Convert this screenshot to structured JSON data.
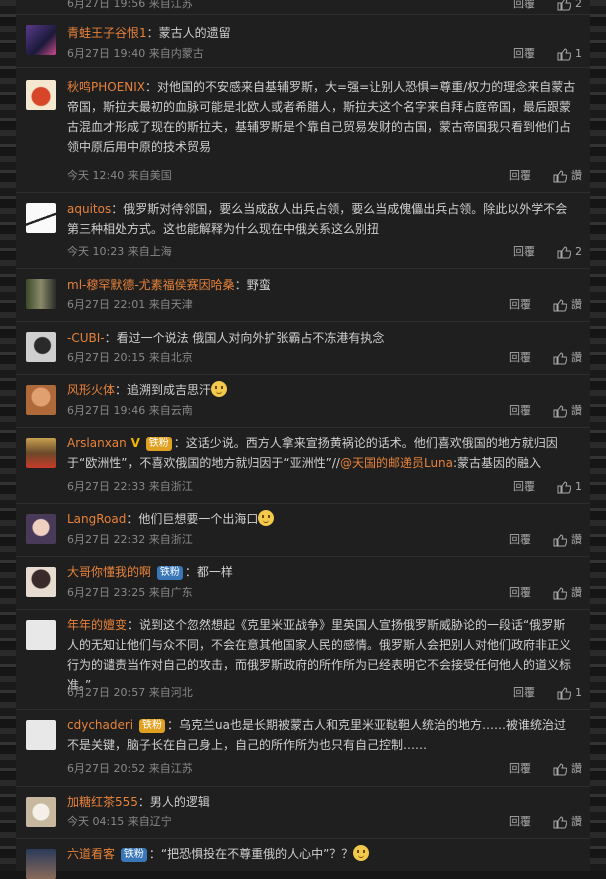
{
  "top_partial": {
    "meta": "6月27日 19:56 来自江苏",
    "reply": "回覆",
    "likes": "2"
  },
  "comments": [
    {
      "user": "青蛙王子谷恨1",
      "text": "蒙古人的遗留",
      "meta": "6月27日 19:40 来自内蒙古",
      "reply": "回覆",
      "likes": "1",
      "avatar": "#3b2a5a"
    },
    {
      "user": "秋鸣PHOENIX",
      "text": "对他国的不安感来自基辅罗斯，大=强=让别人恐惧=尊重/权力的理念来自蒙古帝国，斯拉夫最初的血脉可能是北欧人或者希腊人，斯拉夫这个名字来自拜占庭帝国，最后跟蒙古混血才形成了现在的斯拉夫，基辅罗斯是个靠自己贸易发财的古国，蒙古帝国我只看到他们占领中原后用中原的技术贸易",
      "meta": "今天 12:40 来自美国",
      "reply": "回覆",
      "likes": "讚",
      "avatar": "#c8552a"
    },
    {
      "user": "aquitos",
      "text": "俄罗斯对待邻国，要么当成敌人出兵占领，要么当成傀儡出兵占领。除此以外学不会第三种相处方式。这也能解释为什么现在中俄关系这么别扭",
      "meta": "今天 10:23 来自上海",
      "reply": "回覆",
      "likes": "2",
      "avatar": "#dddddd"
    },
    {
      "user": "ml-穆罕默德-尤素福侯赛因哈桑",
      "text": "野蛮",
      "meta": "6月27日 22:01 来自天津",
      "reply": "回覆",
      "likes": "讚",
      "avatar": "#556a4a"
    },
    {
      "user": "-CUBI-",
      "text": "看过一个说法 俄国人对向外扩张霸占不冻港有执念",
      "meta": "6月27日 20:15 来自北京",
      "reply": "回覆",
      "likes": "讚",
      "avatar": "#444444"
    },
    {
      "user": "风形火体",
      "text": "追溯到成吉思汗",
      "meta": "6月27日 19:46 来自云南",
      "reply": "回覆",
      "likes": "讚",
      "avatar": "#c98a5a",
      "emoji": true
    },
    {
      "user": "Arslanxan",
      "vip": "V",
      "badge": "铁粉",
      "text": "这话少说。西方人拿来宣扬黄祸论的话术。他们喜欢俄国的地方就归因于“欧洲性”，不喜欢俄国的地方就归因于“亚洲性”//",
      "mention": "@天国的邮递员Luna",
      "tail": ":蒙古基因的融入",
      "meta": "6月27日 22:33 来自浙江",
      "reply": "回覆",
      "likes": "1",
      "avatar": "#8a6a3a"
    },
    {
      "user": "LangRoad",
      "text": "他们巨想要一个出海口",
      "meta": "6月27日 22:32 来自浙江",
      "reply": "回覆",
      "likes": "讚",
      "avatar": "#b77a8a",
      "emoji": true
    },
    {
      "user": "大哥你懂我的啊",
      "badge": "铁粉",
      "text": "都一样",
      "meta": "6月27日 23:25 来自广东",
      "reply": "回覆",
      "likes": "讚",
      "avatar": "#e0d0c0"
    },
    {
      "user": "年年的嬗变",
      "text": "说到这个忽然想起《克里米亚战争》里英国人宣扬俄罗斯威胁论的一段话“俄罗斯人的无知让他们与众不同，不会在意其他国家人民的感情。俄罗斯人会把别人对他们政府非正义行为的谴责当作对自己的攻击，而俄罗斯政府的所作所为已经表明它不会接受任何他人的道义标准。”",
      "meta": "6月27日 20:57 来自河北",
      "reply": "回覆",
      "likes": "1",
      "avatar": "#e8e8e8"
    },
    {
      "user": "cdychaderi",
      "badge": "铁粉",
      "text": "乌克兰ua也是长期被蒙古人和克里米亚鞑靼人统治的地方……被谁统治过不是关键，脑子长在自己身上，自己的所作所为也只有自己控制……",
      "meta": "6月27日 20:52 来自江苏",
      "reply": "回覆",
      "likes": "讚",
      "avatar": "#e8e8e8"
    },
    {
      "user": "加糖红茶555",
      "text": "男人的逻辑",
      "meta": "今天 04:15 来自辽宁",
      "reply": "回覆",
      "likes": "讚",
      "avatar": "#d8cfc0"
    },
    {
      "user": "六道看客",
      "badge": "铁粉",
      "text": "“把恐惧投在不尊重俄的人心中”？？",
      "meta": "",
      "reply": "",
      "likes": "",
      "avatar": "#3a4a6a",
      "emoji": true
    }
  ],
  "colors": {
    "bg": "#1f1f1f",
    "username": "#e8823a",
    "badge": "#3a77b8",
    "badge_gold": "#e0a020",
    "meta": "#888888"
  },
  "icons": {
    "like": "thumb-up-icon",
    "emoji": "smile-emoji-icon"
  }
}
